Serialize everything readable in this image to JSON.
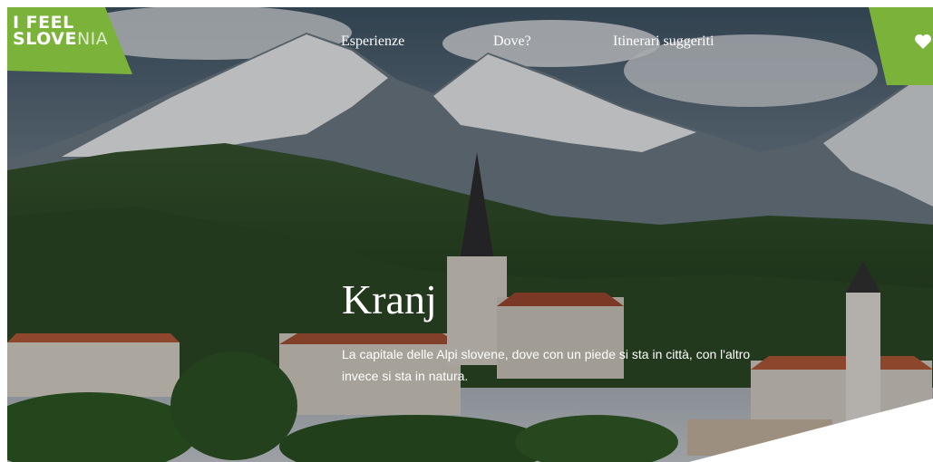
{
  "brand": {
    "line1": "I FEEL",
    "line2_bold_a": "S",
    "line2_bold_b": "LOVE",
    "line2_light": "NIA",
    "color": "#7bb33a"
  },
  "nav": {
    "items": [
      {
        "label": "Esperienze"
      },
      {
        "label": "Dove?"
      },
      {
        "label": "Itinerari suggeriti"
      }
    ]
  },
  "favorites": {
    "icon": "heart-icon"
  },
  "hero": {
    "title": "Kranj",
    "subtitle": "La capitale delle Alpi slovene, dove con un piede si sta in città, con l'altro invece si sta in natura."
  }
}
